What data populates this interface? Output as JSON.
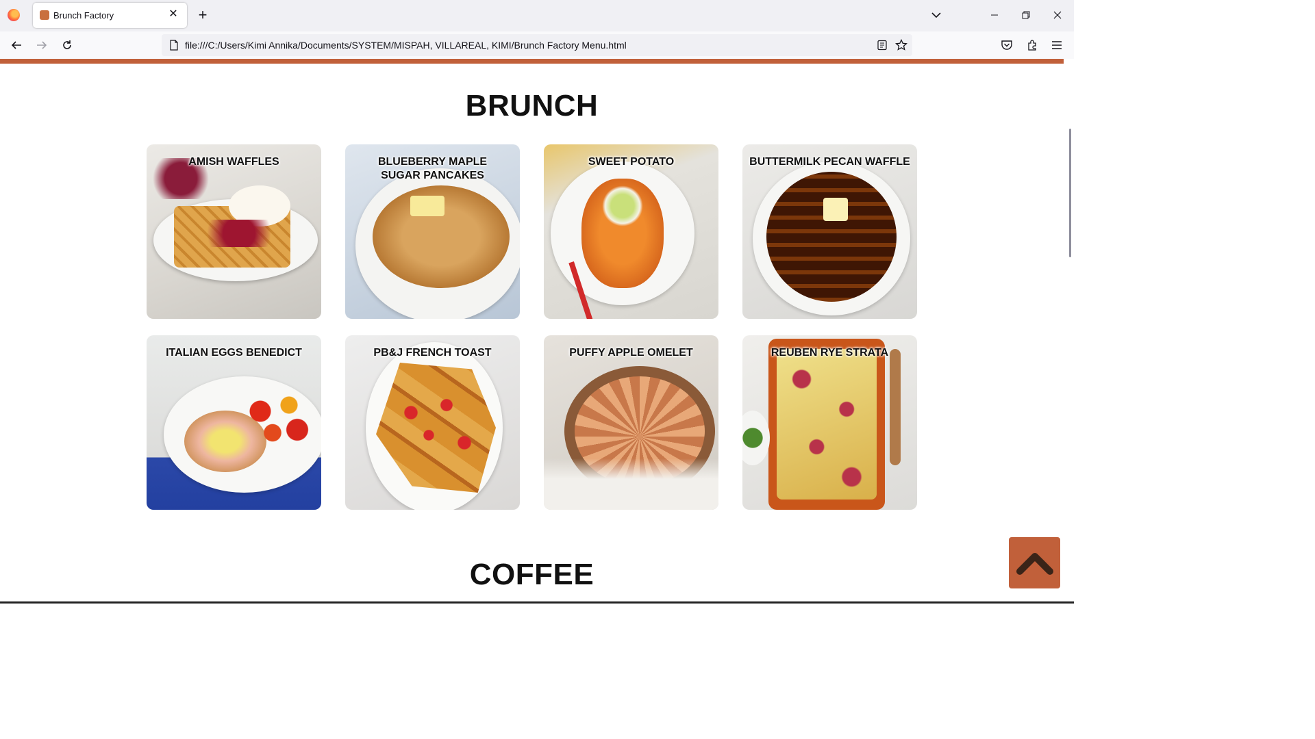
{
  "browser": {
    "tab_title": "Brunch Factory",
    "url": "file:///C:/Users/Kimi Annika/Documents/SYSTEM/MISPAH, VILLAREAL, KIMI/Brunch Factory Menu.html",
    "accent_color": "#c1603a"
  },
  "sections": {
    "brunch_title": "BRUNCH",
    "coffee_title": "COFFEE"
  },
  "brunch_items": [
    {
      "name": "AMISH WAFFLES"
    },
    {
      "name": "BLUEBERRY MAPLE SUGAR PANCAKES"
    },
    {
      "name": "SWEET POTATO"
    },
    {
      "name": "BUTTERMILK PECAN WAFFLE"
    },
    {
      "name": "ITALIAN EGGS BENEDICT"
    },
    {
      "name": "PB&J FRENCH TOAST"
    },
    {
      "name": "PUFFY APPLE OMELET"
    },
    {
      "name": "REUBEN RYE STRATA"
    }
  ],
  "icons": {
    "scroll_top": "chevron-up-icon"
  }
}
